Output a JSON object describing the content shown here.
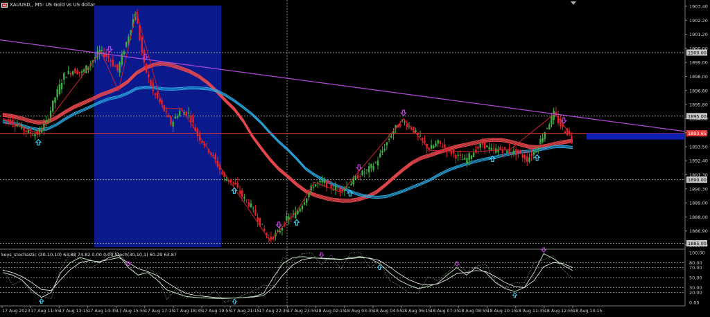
{
  "window": {
    "title": "XAUUSD,, M5:  US Gold vs US dollar",
    "symbol_icon": "chart-symbol-icon"
  },
  "indicator": {
    "header": "keys_stochastic (30,10,10) 63.88 74.82 0.00 0.00 Stoch(30,10,1) 60.29 63.87"
  },
  "price_axis": {
    "labels": [
      "1903.40",
      "1902.20",
      "1901.20",
      "1900.00",
      "1899.00",
      "1898.00",
      "1896.80",
      "1895.80",
      "1894.60",
      "1893.60",
      "1893.50",
      "1892.40",
      "1891.30",
      "1890.30",
      "1889.00",
      "1888.00",
      "1886.90",
      "1885.00"
    ],
    "markers": [
      {
        "value": "1900.00",
        "color": "#c8c8c8",
        "text_color": "#000000"
      },
      {
        "value": "1895.00",
        "color": "#c8c8c8",
        "text_color": "#000000"
      },
      {
        "value": "1893.65",
        "color": "#e03a3a",
        "text_color": "#ffffff"
      },
      {
        "value": "1890.00",
        "color": "#c8c8c8",
        "text_color": "#000000"
      },
      {
        "value": "1885.00",
        "color": "#c8c8c8",
        "text_color": "#000000"
      }
    ]
  },
  "osc_axis": {
    "labels": [
      "100.00",
      "80.00",
      "70.00",
      "50.00",
      "30.00",
      "20.00",
      "0.00"
    ]
  },
  "time_axis": {
    "labels": [
      "17 Aug 2023",
      "17 Aug 11:55",
      "17 Aug 13:15",
      "17 Aug 14:35",
      "17 Aug 15:55",
      "17 Aug 17:15",
      "17 Aug 18:35",
      "17 Aug 19:55",
      "17 Aug 21:15",
      "17 Aug 22:35",
      "17 Aug 23:55",
      "18 Aug 02:15",
      "18 Aug 03:35",
      "18 Aug 04:55",
      "18 Aug 06:15",
      "18 Aug 07:35",
      "18 Aug 08:55",
      "18 Aug 10:15",
      "18 Aug 11:35",
      "18 Aug 12:55",
      "18 Aug 14:15"
    ]
  },
  "chart_data": {
    "type": "line",
    "symbol": "XAUUSD",
    "timeframe": "M5",
    "ylim": [
      1884.7,
      1903.7
    ],
    "bid_price": 1893.65,
    "levels": [
      1900.0,
      1895.0,
      1890.0,
      1885.0
    ],
    "trendline": {
      "start": 1901.0,
      "end": 1893.8,
      "color": "#b04ad8"
    },
    "colors": {
      "bull": "#3cb043",
      "bear": "#e8202a",
      "zone": "#0a1a8c",
      "ma_red": "#e8474c",
      "ma_cyan": "#2aa8e0",
      "arrow_up": "#40c8f0",
      "arrow_down": "#c040d8",
      "stoch_main": "#b8d8b8",
      "stoch_signal": "#ffffff",
      "stoch_dots": "#c0c0c0"
    },
    "price_path": [
      1894.8,
      1894.6,
      1894.2,
      1893.7,
      1893.6,
      1894.5,
      1896.5,
      1898.2,
      1898.6,
      1898.4,
      1899.2,
      1900.1,
      1899.6,
      1898.6,
      1900.8,
      1903.2,
      1899.0,
      1896.9,
      1895.8,
      1894.4,
      1895.4,
      1895.2,
      1893.5,
      1892.6,
      1891.5,
      1890.1,
      1889.8,
      1888.7,
      1887.9,
      1886.6,
      1885.3,
      1885.8,
      1886.9,
      1887.3,
      1888.4,
      1889.6,
      1889.8,
      1889.4,
      1889.2,
      1889.6,
      1890.3,
      1890.7,
      1891.3,
      1892.6,
      1893.9,
      1894.6,
      1894.1,
      1893.2,
      1892.4,
      1892.9,
      1892.4,
      1891.9,
      1891.5,
      1892.2,
      1892.8,
      1892.3,
      1892.4,
      1892.2,
      1892.1,
      1891.6,
      1892.4,
      1893.8,
      1895.2,
      1894.0,
      1893.4
    ],
    "oscillator_main": [
      60,
      55,
      45,
      25,
      10,
      20,
      60,
      80,
      90,
      85,
      80,
      90,
      95,
      70,
      55,
      60,
      45,
      25,
      18,
      12,
      10,
      9,
      8,
      8,
      9,
      10,
      12,
      18,
      50,
      78,
      90,
      92,
      90,
      88,
      87,
      86,
      90,
      92,
      88,
      78,
      60,
      45,
      35,
      28,
      32,
      38,
      55,
      70,
      55,
      70,
      60,
      40,
      28,
      22,
      30,
      60,
      98,
      88,
      75,
      64
    ],
    "oscillator_signal": [
      65,
      60,
      52,
      40,
      26,
      24,
      46,
      66,
      80,
      84,
      82,
      86,
      90,
      80,
      68,
      62,
      54,
      40,
      28,
      18,
      14,
      12,
      10,
      9,
      9,
      10,
      11,
      14,
      30,
      55,
      75,
      86,
      89,
      89,
      88,
      87,
      88,
      90,
      89,
      84,
      72,
      58,
      46,
      38,
      35,
      37,
      46,
      58,
      60,
      64,
      62,
      52,
      40,
      32,
      30,
      44,
      72,
      80,
      78,
      70
    ]
  }
}
